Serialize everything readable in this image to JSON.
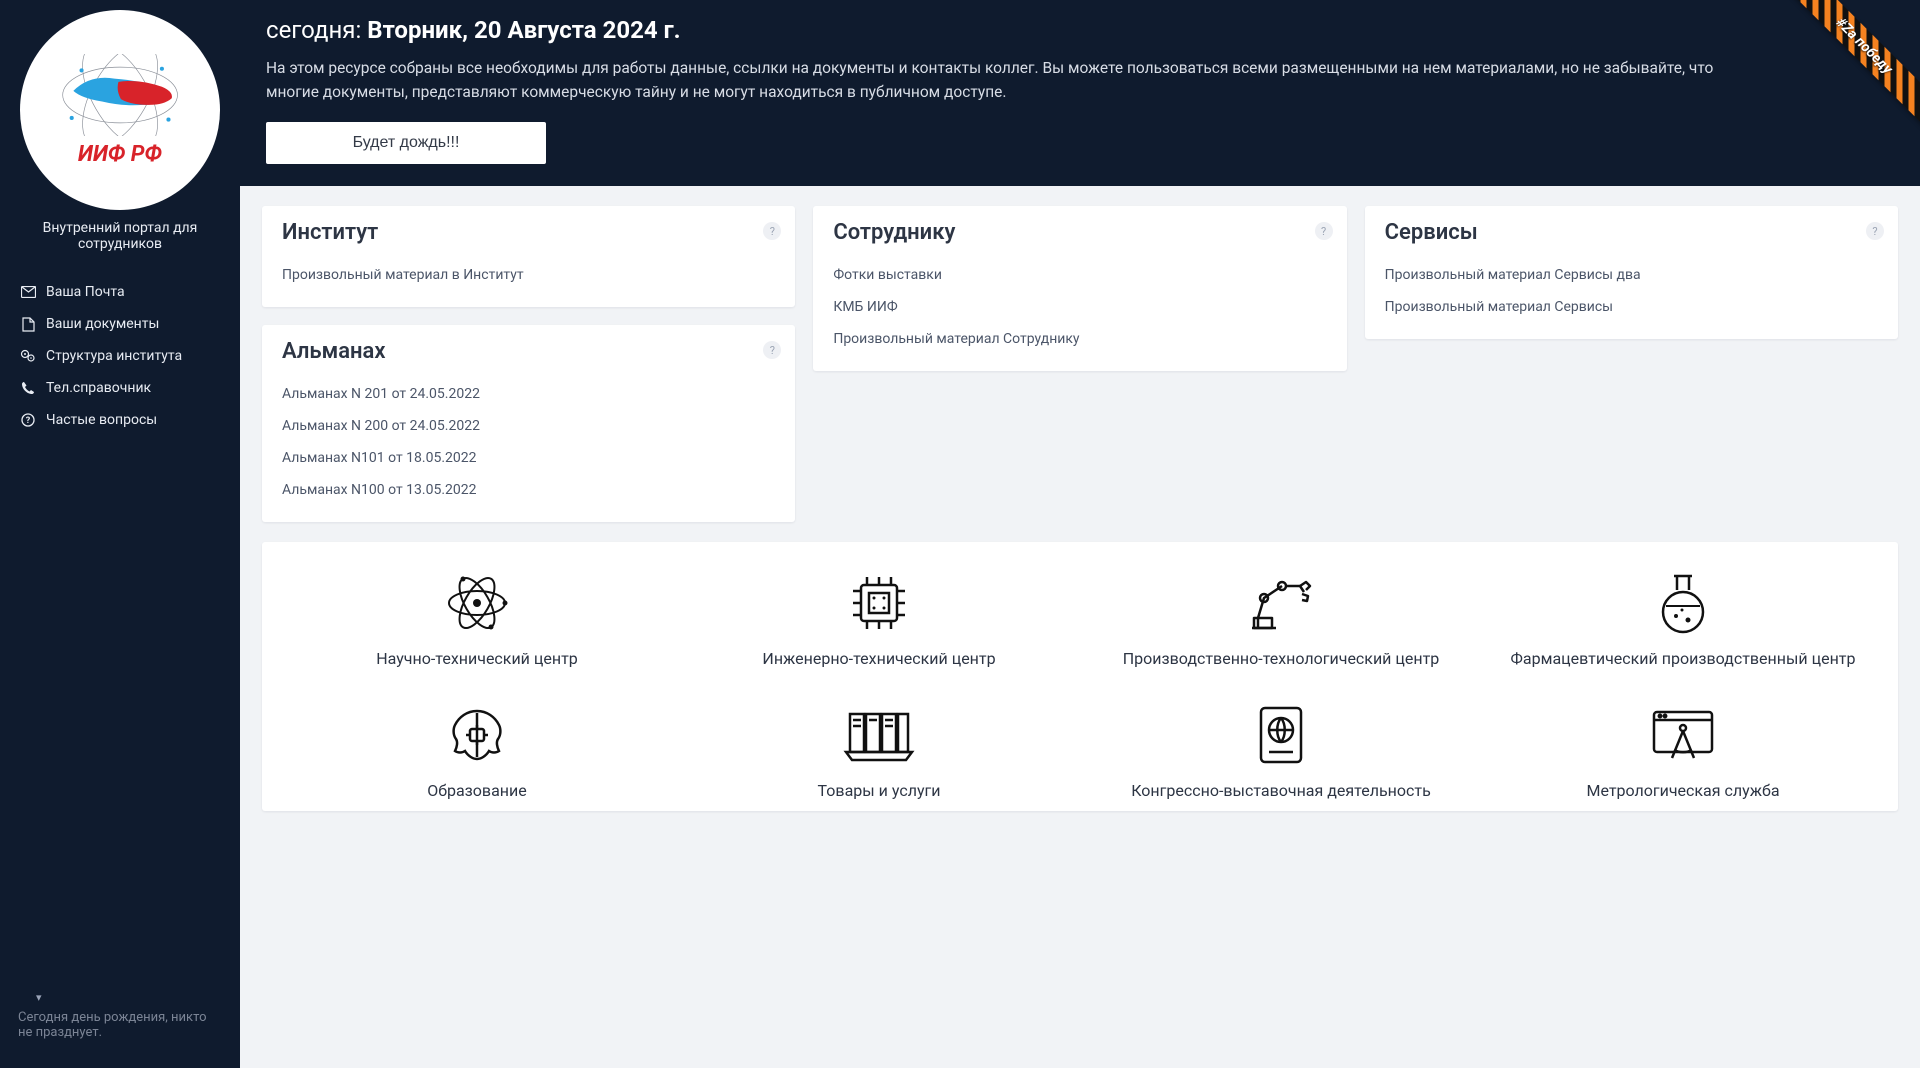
{
  "sidebar": {
    "logo_text": "ИИФ РФ",
    "subtitle": "Внутренний портал для сотрудников",
    "nav": [
      {
        "icon": "mail",
        "label": "Ваша Почта"
      },
      {
        "icon": "doc",
        "label": "Ваши документы"
      },
      {
        "icon": "gears",
        "label": "Структура института"
      },
      {
        "icon": "phone",
        "label": "Тел.справочник"
      },
      {
        "icon": "question",
        "label": "Частые вопросы"
      }
    ],
    "footer": "Сегодня день рождения, никто не празднует."
  },
  "header": {
    "date_prefix": "сегодня: ",
    "date_value": "Вторник, 20 Августа 2024 г.",
    "description": "На этом ресурсе собраны все необходимы для работы данные, ссылки на документы и контакты коллег. Вы можете пользоваться всеми размещенными на нем материалами, но не забывайте, что многие документы, представляют коммерческую тайну и не могут находиться в публичном доступе.",
    "weather_button": "Будет дождь!!!"
  },
  "cards": {
    "institute": {
      "title": "Институт",
      "items": [
        "Произвольный материал в Институт"
      ]
    },
    "employee": {
      "title": "Сотруднику",
      "items": [
        "Фотки выставки",
        "КМБ ИИФ",
        "Произвольный материал Сотруднику"
      ]
    },
    "services": {
      "title": "Сервисы",
      "items": [
        "Произвольный материал Сервисы два",
        "Произвольный материал Сервисы"
      ]
    },
    "almanac": {
      "title": "Альманах",
      "items": [
        "Альманах N 201 от 24.05.2022",
        "Альманах N 200 от 24.05.2022",
        "Альманах N101 от 18.05.2022",
        "Альманах N100 от 13.05.2022"
      ]
    }
  },
  "tiles": [
    {
      "icon": "atom",
      "label": "Научно-технический центр"
    },
    {
      "icon": "chip",
      "label": "Инженерно-технический центр"
    },
    {
      "icon": "robot-arm",
      "label": "Производственно-технологический центр"
    },
    {
      "icon": "flask",
      "label": "Фармацевтический производственный центр"
    },
    {
      "icon": "brain",
      "label": "Образование"
    },
    {
      "icon": "books",
      "label": "Товары и услуги"
    },
    {
      "icon": "passport",
      "label": "Конгрессно-выставочная деятельность"
    },
    {
      "icon": "compass",
      "label": "Метрологическая служба"
    }
  ],
  "ribbon": "#Za победу"
}
